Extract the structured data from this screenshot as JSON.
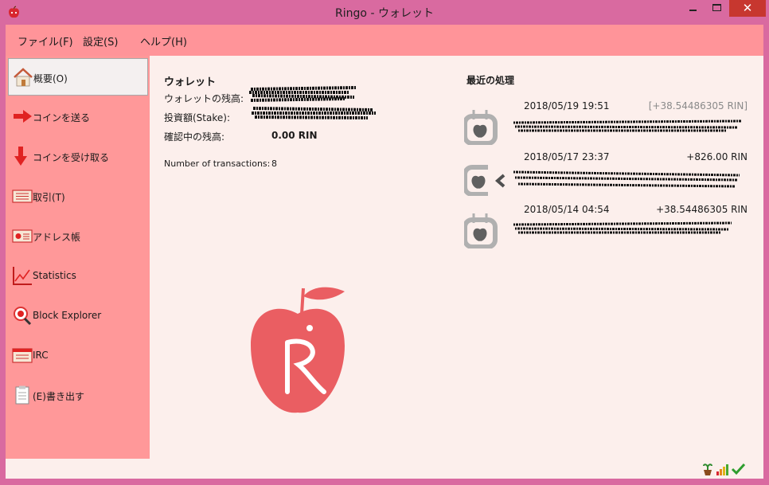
{
  "window": {
    "title": "Ringo - ウォレット"
  },
  "menu": [
    "ファイル(F)",
    "設定(S)",
    "ヘルプ(H)"
  ],
  "sidebar": {
    "items": [
      {
        "label": "概要(O)",
        "icon": "home-icon",
        "active": true
      },
      {
        "label": "コインを送る",
        "icon": "send-arrow-icon"
      },
      {
        "label": "コインを受け取る",
        "icon": "receive-arrow-icon"
      },
      {
        "label": "取引(T)",
        "icon": "transactions-icon"
      },
      {
        "label": "アドレス帳",
        "icon": "address-book-icon"
      },
      {
        "label": "Statistics",
        "icon": "statistics-chart-icon"
      },
      {
        "label": "Block Explorer",
        "icon": "block-explorer-icon"
      },
      {
        "label": "IRC",
        "icon": "irc-icon"
      },
      {
        "label": "(E)書き出す",
        "icon": "export-icon"
      }
    ]
  },
  "wallet": {
    "title": "ウォレット",
    "balance_label": "ウォレットの残高:",
    "stake_label": "投資額(Stake):",
    "unconfirmed_label": "確認中の残高:",
    "unconfirmed_value": "0.00 RIN",
    "tx_count_label": "Number of transactions:",
    "tx_count_value": "8"
  },
  "recent": {
    "title": "最近の処理",
    "transactions": [
      {
        "date": "2018/05/19 19:51",
        "amount": "[+38.54486305 RIN]",
        "pending": true,
        "icon": "mined-apple-icon"
      },
      {
        "date": "2018/05/17 23:37",
        "amount": "+826.00 RIN",
        "pending": false,
        "icon": "received-apple-icon"
      },
      {
        "date": "2018/05/14 04:54",
        "amount": "+38.54486305 RIN",
        "pending": false,
        "icon": "mined-apple-icon"
      }
    ]
  },
  "colors": {
    "titlebar": "#d96aa0",
    "menubar": "#ff9499",
    "sidebar": "#ff9899",
    "content": "#fcefec",
    "logo": "#ea5e62",
    "close": "#c7372f"
  }
}
